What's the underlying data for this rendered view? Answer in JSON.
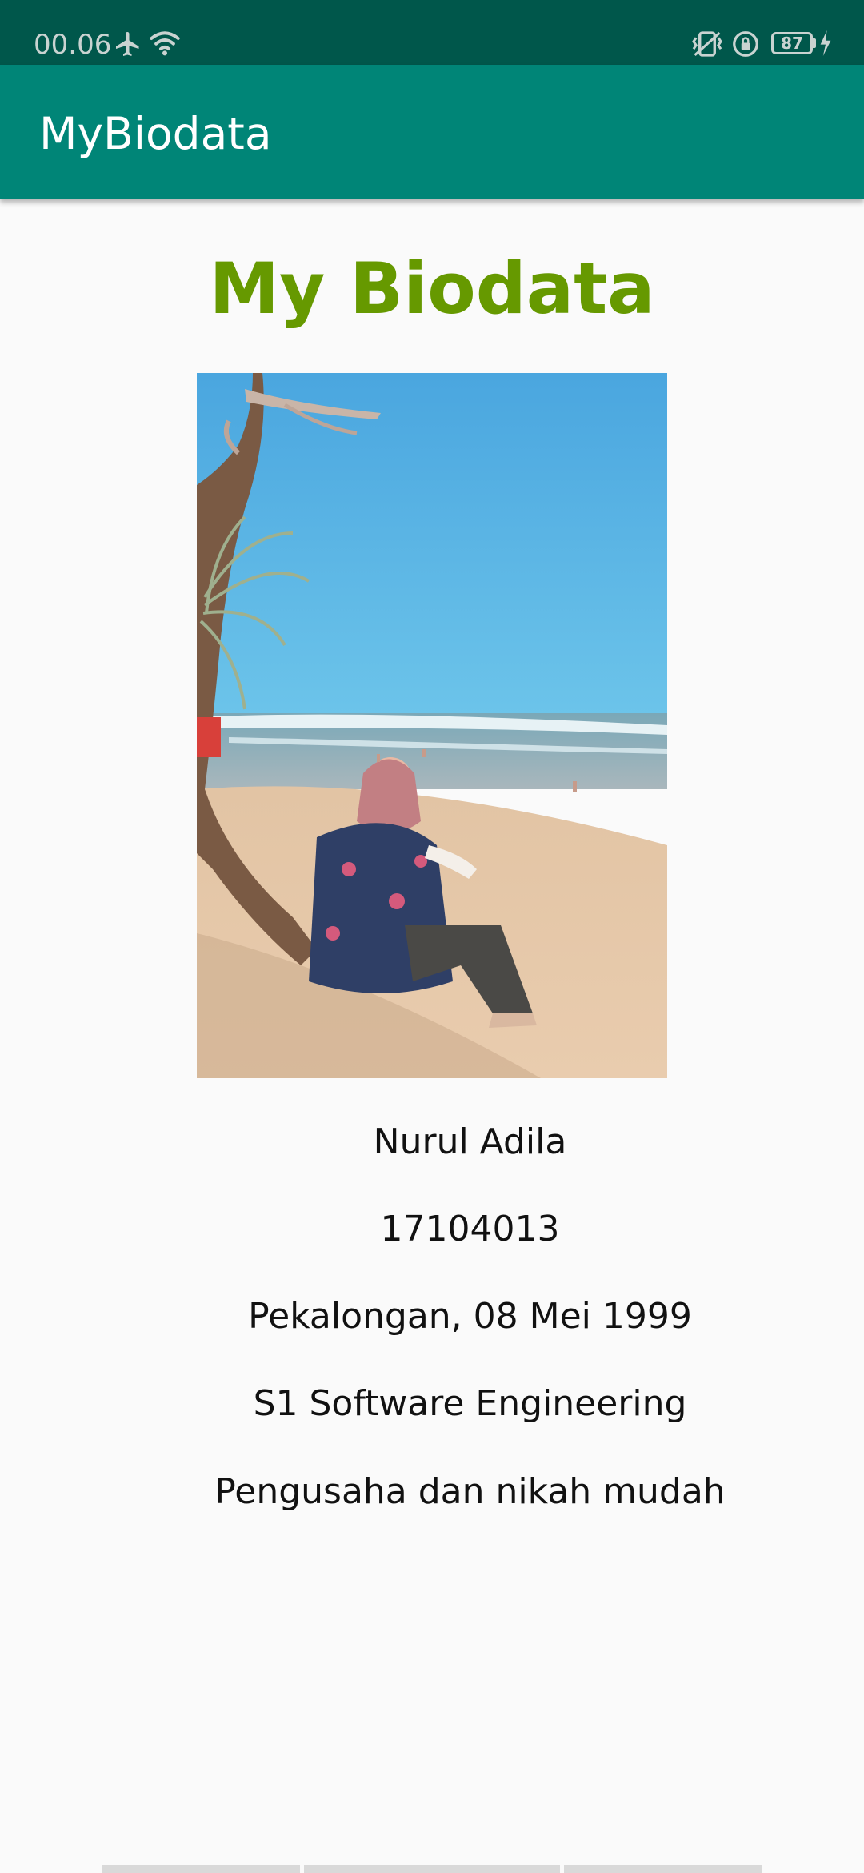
{
  "status_bar": {
    "time": "00.06",
    "battery_level": "87",
    "icons": [
      "airplane-icon",
      "wifi-icon",
      "vibrate-icon",
      "rotation-lock-icon",
      "battery-icon",
      "charging-icon"
    ]
  },
  "app_bar": {
    "title": "MyBiodata",
    "background_color": "#008577",
    "status_color": "#00574b"
  },
  "page": {
    "heading": "My Biodata",
    "heading_color": "#669900",
    "photo": "profile-photo",
    "fields": {
      "name": "Nurul Adila",
      "student_id": "17104013",
      "birth": "Pekalongan, 08 Mei 1999",
      "program": "S1 Software Engineering",
      "aspiration": "Pengusaha dan nikah mudah"
    }
  }
}
